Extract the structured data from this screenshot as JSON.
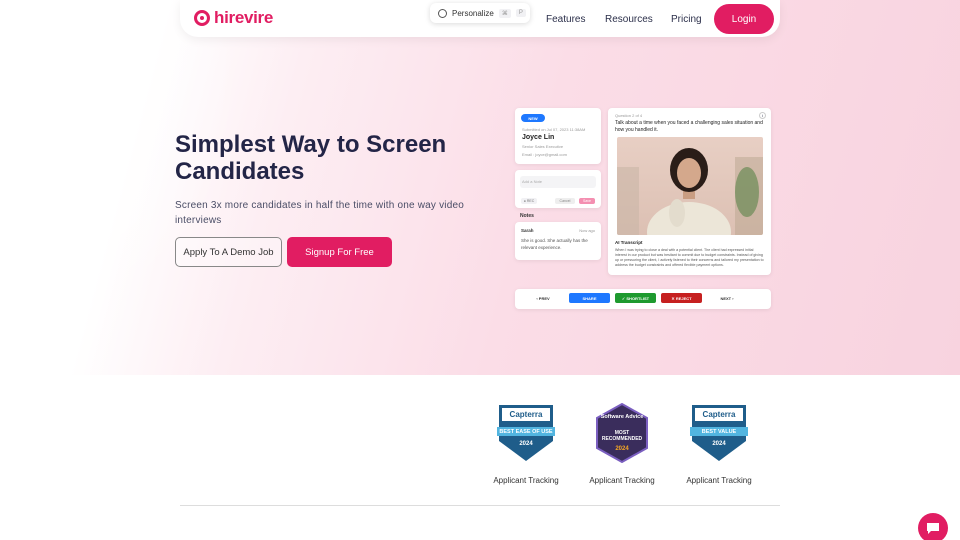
{
  "brand": {
    "name": "hirevire",
    "color": "#e11d62"
  },
  "nav": {
    "personalize": {
      "label": "Personalize",
      "keys": [
        "⌘",
        "P"
      ]
    },
    "links": [
      "Features",
      "Resources",
      "Pricing"
    ],
    "login": "Login"
  },
  "hero": {
    "title": "Simplest Way to Screen Candidates",
    "subtitle": "Screen 3x more candidates in half the time with one way video interviews",
    "demo_button": "Apply To A Demo Job",
    "signup_button": "Signup For Free"
  },
  "mock": {
    "badge": "NEW",
    "submitted": "Submitted on Jul 07, 2023 11:38AM",
    "candidate_name": "Joyce Lin",
    "candidate_role": "Senior Sales Executive",
    "candidate_email": "Email : joyce@gmail.com",
    "note_placeholder": "Add a Note",
    "notes_title": "Notes",
    "note_author": "Sarah",
    "note_time": "Now ago",
    "note_text": "She is good. She actually has the relevant experience.",
    "question_counter": "Question 2 of 4",
    "question": "Talk about a time when you faced a challenging sales situation and how you handled it.",
    "transcript_label": "AI Transcript",
    "transcript": "When I was trying to close a deal with a potential client. The client had expressed initial interest in our product but was hesitant to commit due to budget constraints. Instead of giving up or pressuring the client, I actively listened to their concerns and tailored my presentation to address the budget constraints and offered flexible payment options.",
    "actions": {
      "prev": "‹ PREV",
      "share": "SHARE",
      "shortlist": "✓ SHORTLIST",
      "reject": "✕ REJECT",
      "next": "NEXT ›"
    }
  },
  "awards": [
    {
      "brand": "Capterra",
      "line1": "BEST EASE OF USE",
      "year": "2024",
      "caption": "Applicant Tracking",
      "color": "#1f5d8a"
    },
    {
      "brand": "Software Advice",
      "line1": "MOST RECOMMENDED",
      "year": "2024",
      "caption": "Applicant Tracking",
      "color": "#3a2d5c"
    },
    {
      "brand": "Capterra",
      "line1": "BEST VALUE",
      "year": "2024",
      "caption": "Applicant Tracking",
      "color": "#1f5d8a"
    }
  ]
}
